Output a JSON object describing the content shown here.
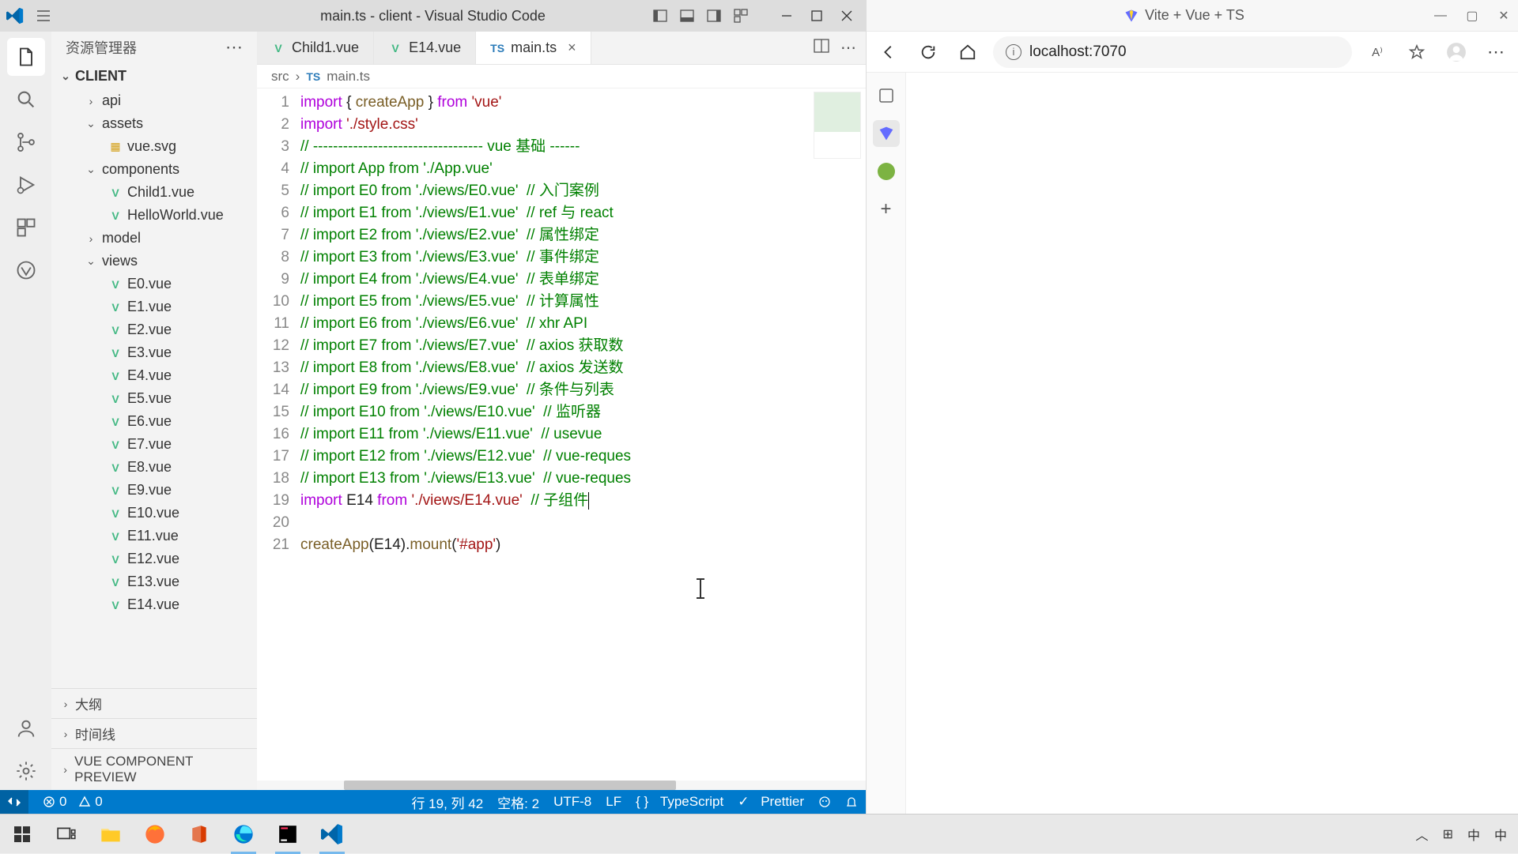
{
  "vscode": {
    "title": "main.ts - client - Visual Studio Code",
    "sidebar": {
      "header": "资源管理器",
      "root": "CLIENT",
      "tree": {
        "api": "api",
        "assets": "assets",
        "vue_svg": "vue.svg",
        "components": "components",
        "child1": "Child1.vue",
        "hello": "HelloWorld.vue",
        "model": "model",
        "views": "views",
        "files": [
          "E0.vue",
          "E1.vue",
          "E2.vue",
          "E3.vue",
          "E4.vue",
          "E5.vue",
          "E6.vue",
          "E7.vue",
          "E8.vue",
          "E9.vue",
          "E10.vue",
          "E11.vue",
          "E12.vue",
          "E13.vue",
          "E14.vue"
        ]
      },
      "outline": "大纲",
      "timeline": "时间线",
      "preview": "VUE COMPONENT PREVIEW"
    },
    "tabs": {
      "t1": "Child1.vue",
      "t2": "E14.vue",
      "t3": "main.ts"
    },
    "breadcrumb": {
      "p1": "src",
      "p2": "main.ts"
    },
    "status": {
      "errors": "0",
      "warnings": "0",
      "pos": "行 19, 列 42",
      "spaces": "空格: 2",
      "enc": "UTF-8",
      "eol": "LF",
      "lang": "TypeScript",
      "prettier": "Prettier"
    }
  },
  "browser": {
    "title": "Vite + Vue + TS",
    "url": "localhost:7070"
  },
  "ime": {
    "zh1": "中",
    "zh2": "中"
  },
  "code": {
    "l1": {
      "a": "import",
      "b": " { ",
      "c": "createApp",
      "d": " } ",
      "e": "from",
      "f": " ",
      "g": "'vue'"
    },
    "l2": {
      "a": "import",
      "b": " ",
      "c": "'./style.css'"
    },
    "l3": "// ---------------------------------- vue 基础 ------",
    "l4": "// import App from './App.vue'",
    "l5": "// import E0 from './views/E0.vue'  // 入门案例",
    "l6": "// import E1 from './views/E1.vue'  // ref 与 react",
    "l7": "// import E2 from './views/E2.vue'  // 属性绑定",
    "l8": "// import E3 from './views/E3.vue'  // 事件绑定",
    "l9": "// import E4 from './views/E4.vue'  // 表单绑定",
    "l10": "// import E5 from './views/E5.vue'  // 计算属性",
    "l11": "// import E6 from './views/E6.vue'  // xhr API",
    "l12": "// import E7 from './views/E7.vue'  // axios 获取数",
    "l13": "// import E8 from './views/E8.vue'  // axios 发送数",
    "l14": "// import E9 from './views/E9.vue'  // 条件与列表",
    "l15": "// import E10 from './views/E10.vue'  // 监听器",
    "l16": "// import E11 from './views/E11.vue'  // usevue",
    "l17": "// import E12 from './views/E12.vue'  // vue-reques",
    "l18": "// import E13 from './views/E13.vue'  // vue-reques",
    "l19": {
      "a": "import",
      "b": " E14 ",
      "c": "from",
      "d": " ",
      "e": "'./views/E14.vue'",
      "f": "  ",
      "g": "// 子组件"
    },
    "l21": {
      "a": "createApp",
      "b": "(E14).",
      "c": "mount",
      "d": "(",
      "e": "'#app'",
      "f": ")"
    }
  }
}
